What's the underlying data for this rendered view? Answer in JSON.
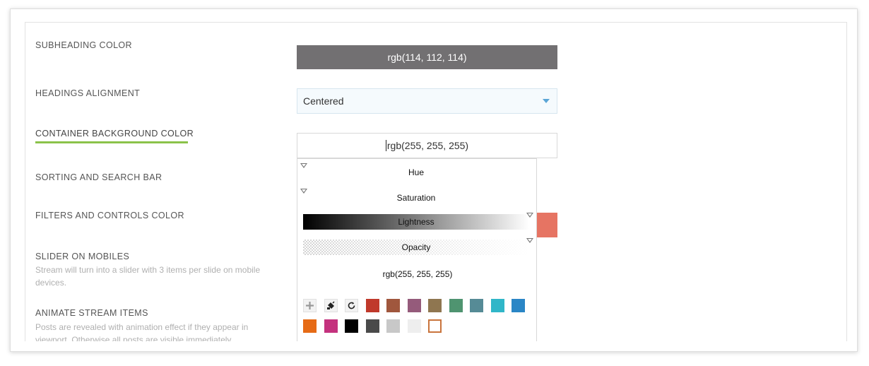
{
  "rows": {
    "subheading_color": {
      "label": "SUBHEADING COLOR",
      "value": "rgb(114, 112, 114)"
    },
    "headings_alignment": {
      "label": "HEADINGS ALIGNMENT",
      "value": "Centered"
    },
    "container_bg_color": {
      "label": "CONTAINER BACKGROUND COLOR",
      "value": "rgb(255, 255, 255)"
    },
    "sorting_search_bar": {
      "label": "SORTING AND SEARCH BAR"
    },
    "filters_controls_color": {
      "label": "FILTERS AND CONTROLS COLOR"
    },
    "slider_on_mobiles": {
      "label": "SLIDER ON MOBILES",
      "description": "Stream will turn into a slider with 3 items per slide on mobile devices."
    },
    "animate_stream_items": {
      "label": "ANIMATE STREAM ITEMS",
      "description": "Posts are revealed with animation effect if they appear in viewport. Otherwise all posts are visible immediately."
    }
  },
  "picker": {
    "hue_label": "Hue",
    "saturation_label": "Saturation",
    "lightness_label": "Lightness",
    "opacity_label": "Opacity",
    "value": "rgb(255, 255, 255)",
    "tools": [
      "plus-icon",
      "paint-bucket-icon",
      "reset-icon"
    ],
    "palette_row1": [
      "#c0392b",
      "#a0573d",
      "#955b7b",
      "#8f7650",
      "#4f9470",
      "#568b96",
      "#30b6c8",
      "#2a86c6"
    ],
    "palette_row2": [
      "#e66b16",
      "#c4327e",
      "#000000",
      "#4a4a4a",
      "#c8c8c8",
      "#eeeeee",
      "#ffffff"
    ]
  },
  "colors": {
    "accent_underline": "#8bc34a",
    "subheading_swatch": "#727072",
    "filters_preview": "#e67463",
    "select_caret": "#5aa5d6"
  }
}
